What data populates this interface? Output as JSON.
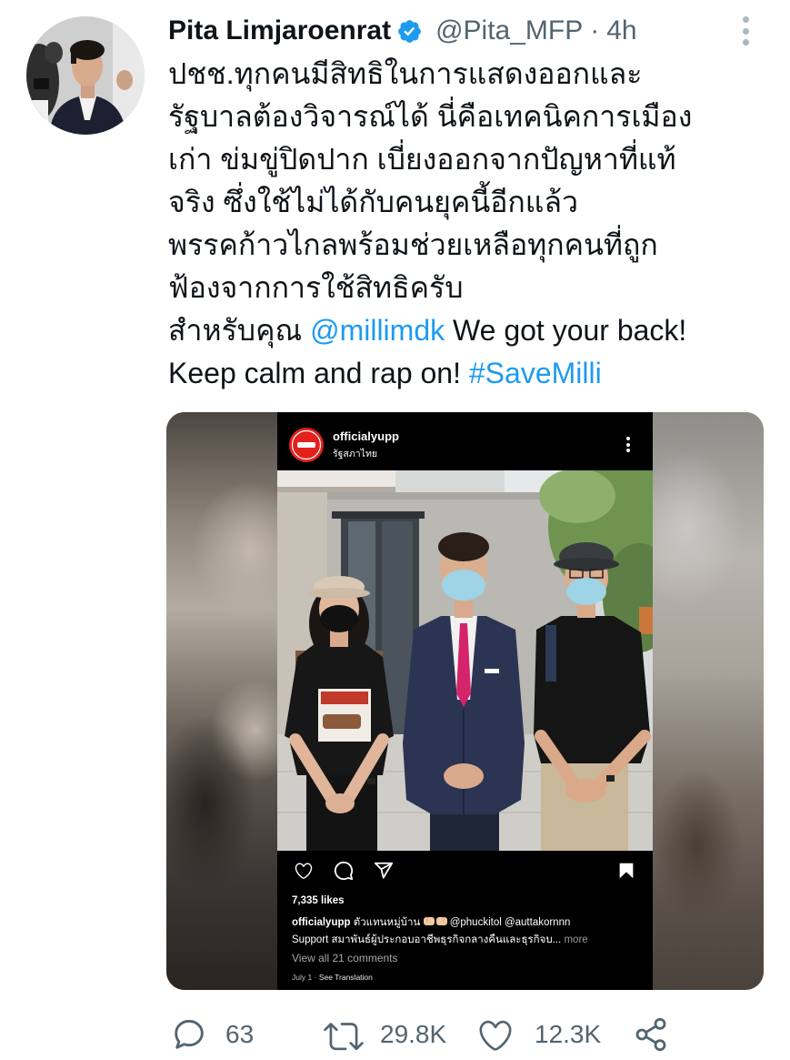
{
  "tweet": {
    "author_name": "Pita Limjaroenrat",
    "handle": "@Pita_MFP",
    "separator": "·",
    "time": "4h",
    "verified": true,
    "body": [
      [
        {
          "text": "ปชช.ทุกคนมีสิทธิในการแสดงออกและ"
        }
      ],
      [
        {
          "text": "รัฐบาลต้องวิจารณ์ได้ นี่คือเทคนิคการเมือง"
        }
      ],
      [
        {
          "text": "เก่า ข่มขู่ปิดปาก เบี่ยงออกจากปัญหาที่แท้"
        }
      ],
      [
        {
          "text": "จริง ซึ่งใช้ไม่ได้กับคนยุคนี้อีกแล้ว"
        }
      ],
      [
        {
          "text": "พรรคก้าวไกลพร้อมช่วยเหลือทุกคนที่ถูก"
        }
      ],
      [
        {
          "text": "ฟ้องจากการใช้สิทธิครับ"
        }
      ],
      [
        {
          "text": "สำหรับคุณ "
        },
        {
          "text": "@millimdk",
          "link": true
        },
        {
          "text": " We got your back!"
        }
      ],
      [
        {
          "text": "Keep calm and rap on! "
        },
        {
          "text": "#SaveMilli",
          "link": true
        }
      ]
    ],
    "stats": {
      "replies": "63",
      "retweets": "29.8K",
      "likes": "12.3K"
    }
  },
  "embed": {
    "account": "officialyupp",
    "subtitle": "รัฐสภาไทย",
    "likes": "7,335 likes",
    "caption_user": "officialyupp",
    "caption_text": "ตัวแทนหมู่บ้าน",
    "caption_mentions": "@phuckitol @auttakornnn",
    "caption_line2": "Support สมาพันธ์ผู้ประกอบอาชีพธุรกิจกลางคืนและธุรกิจบ...",
    "more": "more",
    "view_comments": "View all 21 comments",
    "date": "July 1",
    "date_separator": "·",
    "see_translation": "See Translation"
  },
  "icons": {
    "verified": "verified-badge-icon",
    "tweet_menu": "more-vertical-icon",
    "reply": "reply-icon",
    "retweet": "retweet-icon",
    "like": "heart-icon",
    "share": "share-icon",
    "ig_menu": "more-vertical-icon",
    "ig_like": "heart-icon",
    "ig_comment": "comment-icon",
    "ig_send": "send-icon",
    "ig_save": "bookmark-icon",
    "caption_emoji": "fist-bump-emoji-icon"
  },
  "colors": {
    "text": "#0f1419",
    "muted": "#536471",
    "link": "#1d9bf0",
    "verified": "#1d9bf0",
    "embed_background": "#000000",
    "brand_red": "#e3201b"
  }
}
